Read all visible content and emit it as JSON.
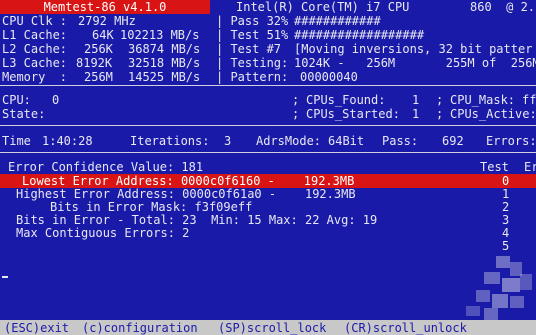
{
  "header": {
    "title": "Memtest-86 v4.1.0",
    "cpu": "Intel(R) Core(TM) i7 CPU",
    "cpu_speed": "860  @ 2.",
    "rows": [
      {
        "label": "CPU Clk :",
        "size": "2792 MHz",
        "speed": "",
        "pass_label": "| Pass 32%",
        "pass_value": "############"
      },
      {
        "label": "L1 Cache:",
        "size": "64K",
        "speed": "102213 MB/s",
        "pass_label": "| Test 51%",
        "pass_value": "##################"
      },
      {
        "label": "L2 Cache:",
        "size": "256K",
        "speed": "36874 MB/s",
        "pass_label": "| Test #7",
        "pass_value": "[Moving inversions, 32 bit patter"
      },
      {
        "label": "L3 Cache:",
        "size": "8192K",
        "speed": "32518 MB/s",
        "pass_label": "| Testing:",
        "pass_value": "1024K -   256M       255M of  256M"
      },
      {
        "label": "Memory  :",
        "size": "256M",
        "speed": "14525 MB/s",
        "pass_label": "| Pattern:",
        "pass_value": "00000040"
      }
    ]
  },
  "cpu_panel": {
    "cpu_label": "CPU:",
    "cpu_value": "0",
    "state_label": "State:",
    "found_label": "CPUs_Found:",
    "found_value": "1",
    "mask_label": "CPU_Mask:",
    "mask_value": "ff",
    "started_label": "CPUs_Started:",
    "started_value": "1",
    "active_label": "CPUs_Active:"
  },
  "status": {
    "time_label": "Time",
    "time_value": "1:40:28",
    "iter_label": "Iterations:",
    "iter_value": "3",
    "mode_label": "AdrsMode:",
    "mode_value": "64Bit",
    "pass_label": "Pass:",
    "pass_value": "692",
    "errors_label": "Errors:"
  },
  "errors": {
    "confidence": "Error Confidence Value: 181",
    "col_test": "Test",
    "col_errors": "Er",
    "lines": [
      {
        "text": "Lowest Error Address: 0000c0f6160 -    192.3MB",
        "highlight": true
      },
      {
        "text": "Highest Error Address: 0000c0f61a0 -    192.3MB",
        "highlight": false
      },
      {
        "text": "Bits in Error Mask: f3f09eff",
        "highlight": false
      },
      {
        "text": "Bits in Error - Total: 23  Min: 15 Max: 22 Avg: 19",
        "highlight": false
      },
      {
        "text": "Max Contiguous Errors: 2",
        "highlight": false
      }
    ],
    "test_numbers": [
      "0",
      "1",
      "2",
      "3",
      "4",
      "5"
    ]
  },
  "footer": {
    "keys": [
      "(ESC)exit",
      "(c)configuration",
      "(SP)scroll_lock",
      "(CR)scroll_unlock"
    ]
  },
  "colors": {
    "background": "#1a1aa8",
    "highlight": "#d81414",
    "text": "#e8e8f4",
    "footer": "#c8c8c8"
  }
}
